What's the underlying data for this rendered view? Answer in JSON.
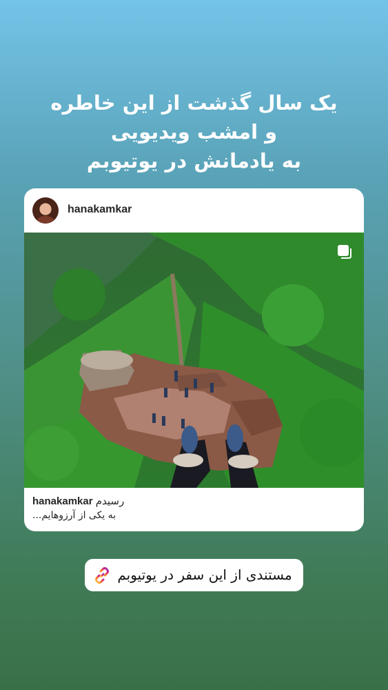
{
  "story": {
    "headline_lines": [
      "یک سال گذشت از این خاطره",
      "و امشب ویدیویی",
      "به یادمانش در یوتیوبم"
    ]
  },
  "post": {
    "username": "hanakamkar",
    "caption_username": "hanakamkar",
    "caption_word": "رسیدم",
    "caption_line2": "به یکی از آرزوهایم...",
    "multi_photo_icon": "carousel-icon"
  },
  "link_sticker": {
    "label": "مستندی از این سفر در یوتیوبم",
    "icon": "link-icon"
  }
}
